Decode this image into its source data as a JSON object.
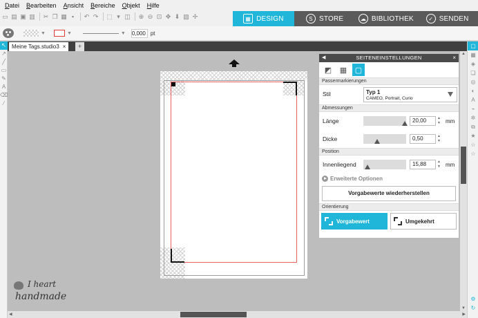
{
  "menu": [
    "Datei",
    "Bearbeiten",
    "Ansicht",
    "Bereiche",
    "Objekt",
    "Hilfe"
  ],
  "modes": [
    {
      "label": "DESIGN",
      "icon": "grid-icon",
      "active": true
    },
    {
      "label": "STORE",
      "icon": "store-icon",
      "active": false
    },
    {
      "label": "BIBLIOTHEK",
      "icon": "cloud-icon",
      "active": false
    },
    {
      "label": "SENDEN",
      "icon": "send-check-icon",
      "active": false
    }
  ],
  "style": {
    "line_width": "0,000",
    "unit": "pt",
    "line_color": "#e53935"
  },
  "tabs": {
    "doc_name": "Meine Tags.studio3",
    "close": "×",
    "add": "+"
  },
  "panel": {
    "title": "SEITENEINSTELLUNGEN",
    "sections": {
      "pass": "Passermarkierungen",
      "abm": "Abmessungen",
      "pos": "Position",
      "orient": "Orientierung"
    },
    "stil": {
      "label": "Stil",
      "value": "Typ 1",
      "sub": "CAMEO, Portrait, Curio"
    },
    "laenge": {
      "label": "Länge",
      "value": "20,00",
      "unit": "mm"
    },
    "dicke": {
      "label": "Dicke",
      "value": "0,50"
    },
    "innen": {
      "label": "Innenliegend",
      "value": "15,88",
      "unit": "mm"
    },
    "extra": "Erweiterte Optionen",
    "reset": "Vorgabewerte wiederherstellen",
    "orient_std": "Vorgabewert",
    "orient_rev": "Umgekehrt"
  },
  "logo": {
    "line1": "I heart",
    "line2": "handmade"
  },
  "colors": {
    "accent": "#1fb6d9",
    "mode_bg": "#5a5a5a",
    "cut_line": "#e86060"
  }
}
